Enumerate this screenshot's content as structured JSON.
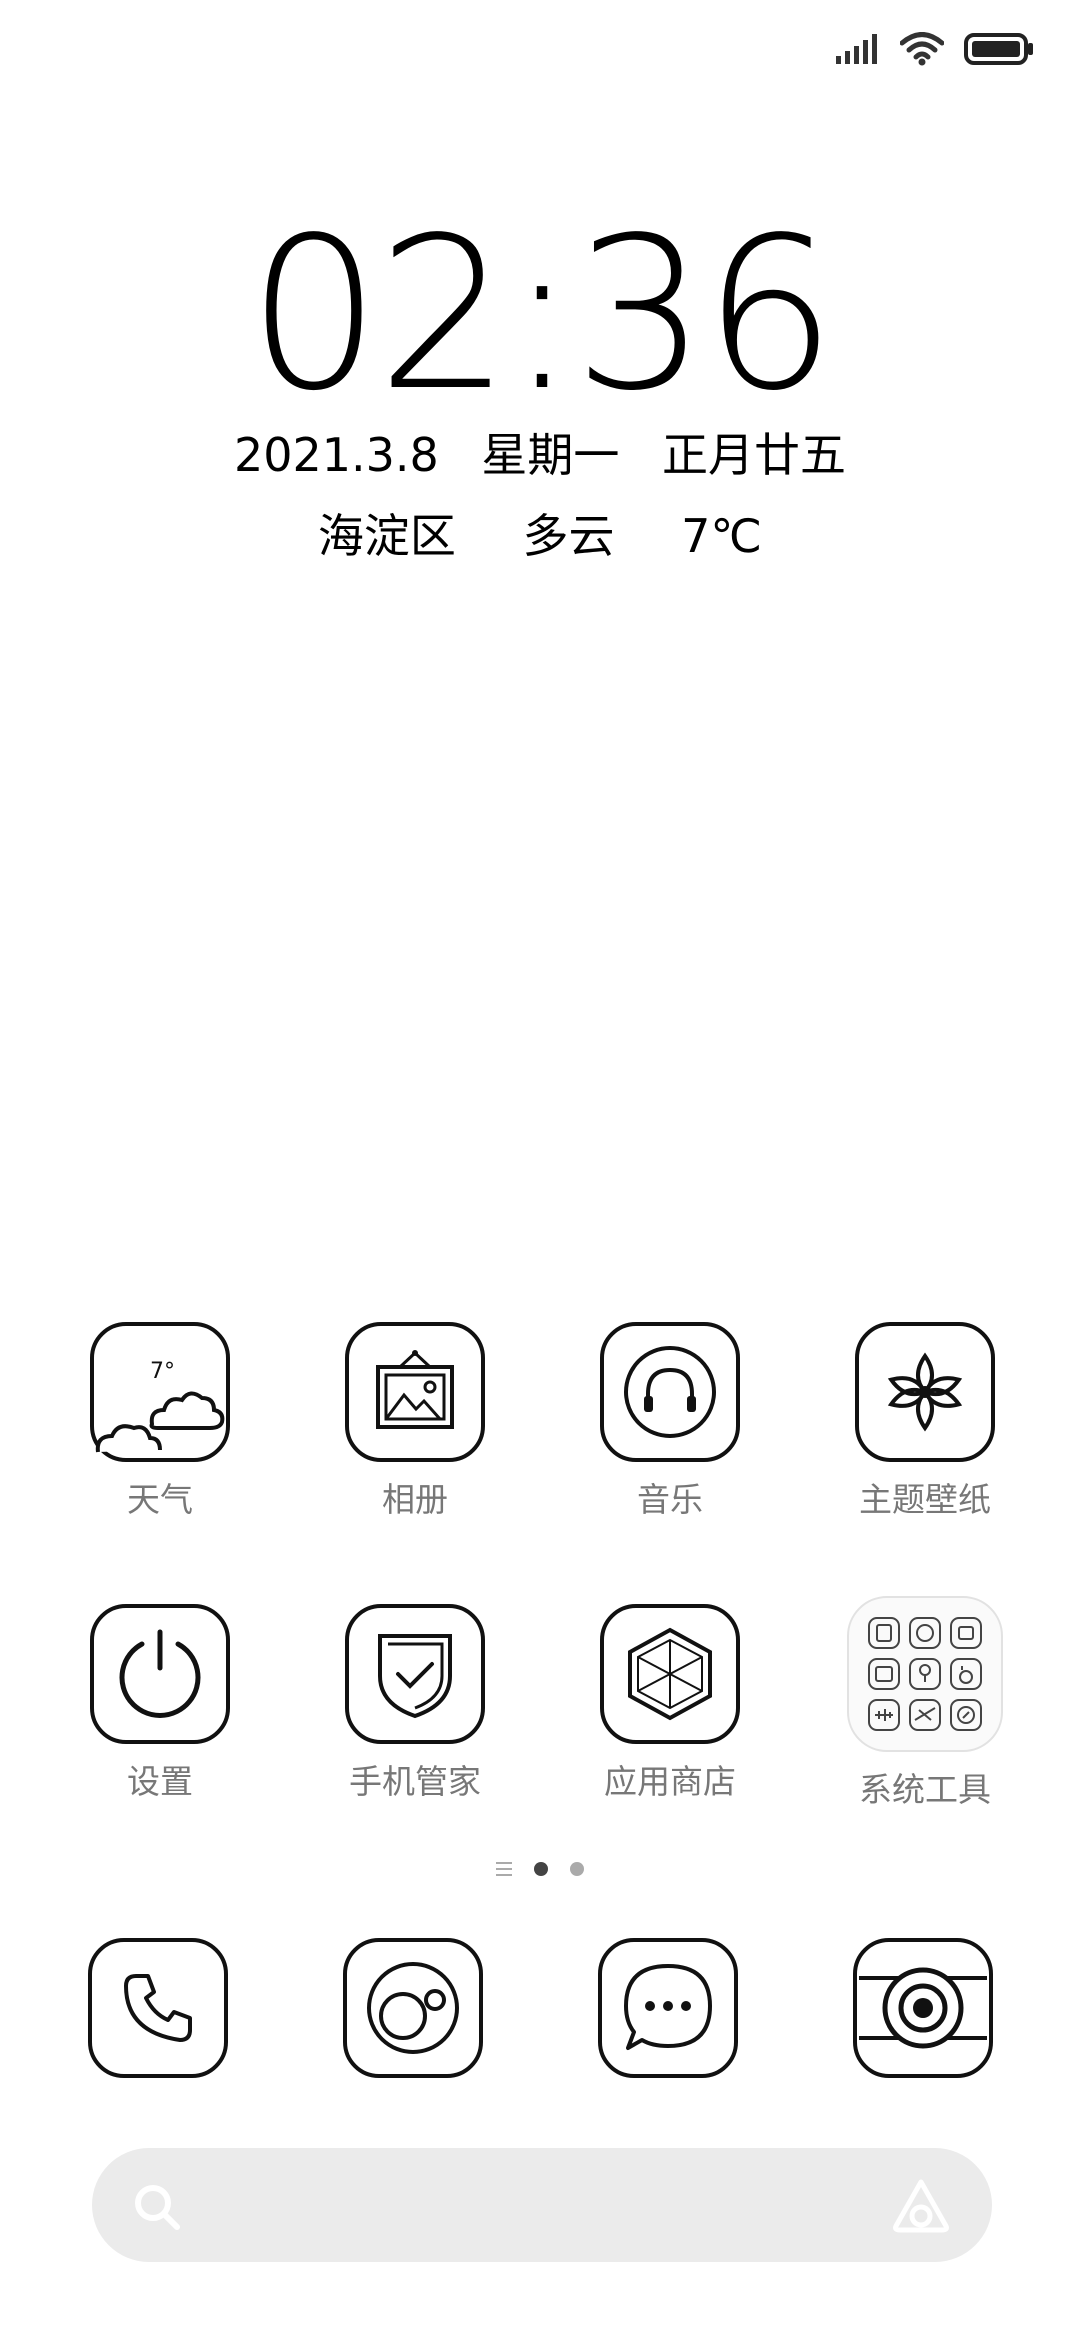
{
  "status_bar": {
    "icons": [
      "signal-icon",
      "wifi-icon",
      "battery-icon"
    ]
  },
  "lockscreen": {
    "time": "02:36",
    "date": "2021.3.8",
    "weekday": "星期一",
    "lunar_date": "正月廿五",
    "location": "海淀区",
    "weather": "多云",
    "temperature": "7℃"
  },
  "apps": [
    {
      "label": "天气",
      "icon": "weather-icon",
      "badge": "7°"
    },
    {
      "label": "相册",
      "icon": "gallery-icon"
    },
    {
      "label": "音乐",
      "icon": "music-icon"
    },
    {
      "label": "主题壁纸",
      "icon": "themes-icon"
    },
    {
      "label": "设置",
      "icon": "settings-icon"
    },
    {
      "label": "手机管家",
      "icon": "security-icon"
    },
    {
      "label": "应用商店",
      "icon": "app-store-icon"
    },
    {
      "label": "系统工具",
      "icon": "tools-folder-icon"
    }
  ],
  "pager": {
    "pages": 2,
    "active": 1
  },
  "dock": [
    {
      "icon": "phone-icon"
    },
    {
      "icon": "browser-icon"
    },
    {
      "icon": "messages-icon"
    },
    {
      "icon": "camera-icon"
    }
  ],
  "search": {
    "icons": [
      "search-icon",
      "assistant-icon"
    ]
  }
}
